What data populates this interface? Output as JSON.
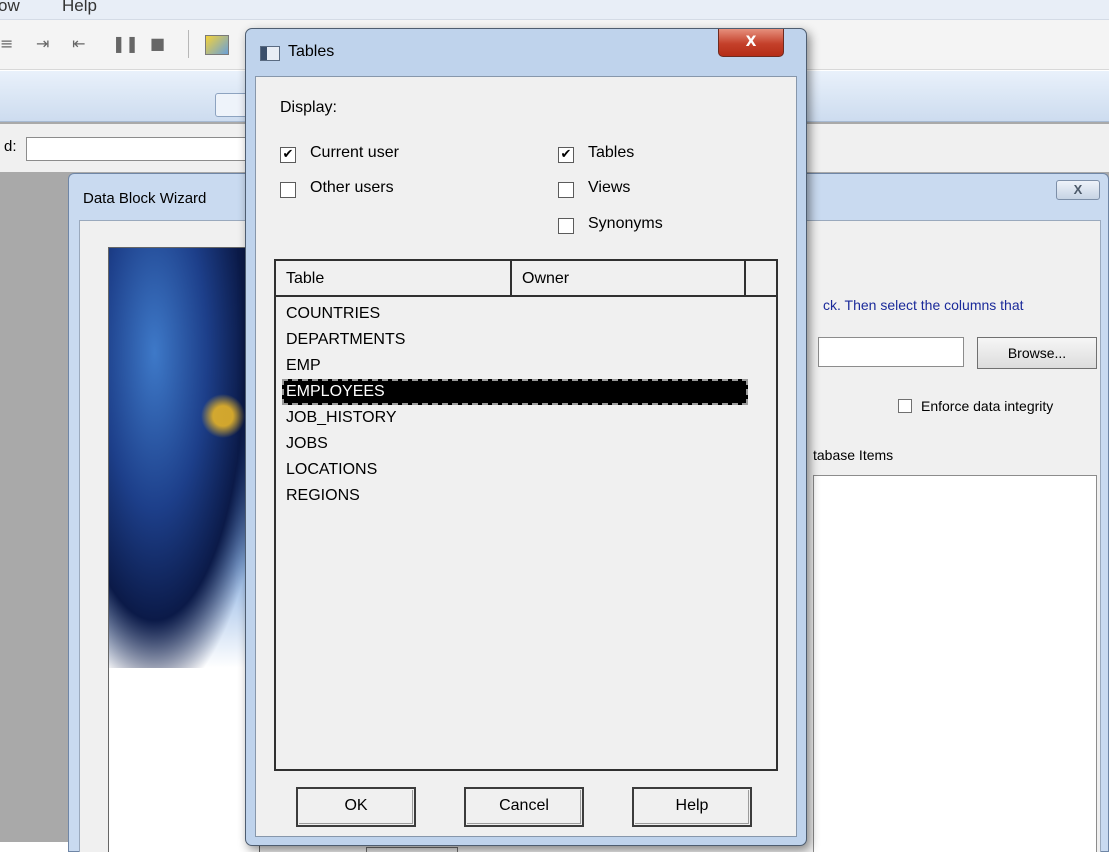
{
  "app": {
    "menu": [
      "ow",
      "Help"
    ],
    "toolbar_icons": [
      "align-center-icon",
      "indent-icon",
      "outdent-icon",
      "pause-icon",
      "stop-icon",
      "data-block-wizard-icon"
    ],
    "find_label": "d:"
  },
  "wizard": {
    "title": "Data Block Wizard",
    "instruction": "ck. Then select the columns that",
    "browse_label": "Browse...",
    "enforce_label": "Enforce data integrity",
    "enforce_checked": false,
    "db_items_label": "tabase Items"
  },
  "tables_dialog": {
    "title": "Tables",
    "close_glyph": "X",
    "display_label": "Display:",
    "options": {
      "current_user": {
        "label": "Current user",
        "checked": true
      },
      "other_users": {
        "label": "Other users",
        "checked": false
      },
      "tables": {
        "label": "Tables",
        "checked": true
      },
      "views": {
        "label": "Views",
        "checked": false
      },
      "synonyms": {
        "label": "Synonyms",
        "checked": false
      }
    },
    "columns": [
      "Table",
      "Owner"
    ],
    "rows": [
      "COUNTRIES",
      "DEPARTMENTS",
      "EMP",
      "EMPLOYEES",
      "JOB_HISTORY",
      "JOBS",
      "LOCATIONS",
      "REGIONS"
    ],
    "selected_row": "EMPLOYEES",
    "buttons": {
      "ok": "OK",
      "cancel": "Cancel",
      "help": "Help"
    }
  }
}
